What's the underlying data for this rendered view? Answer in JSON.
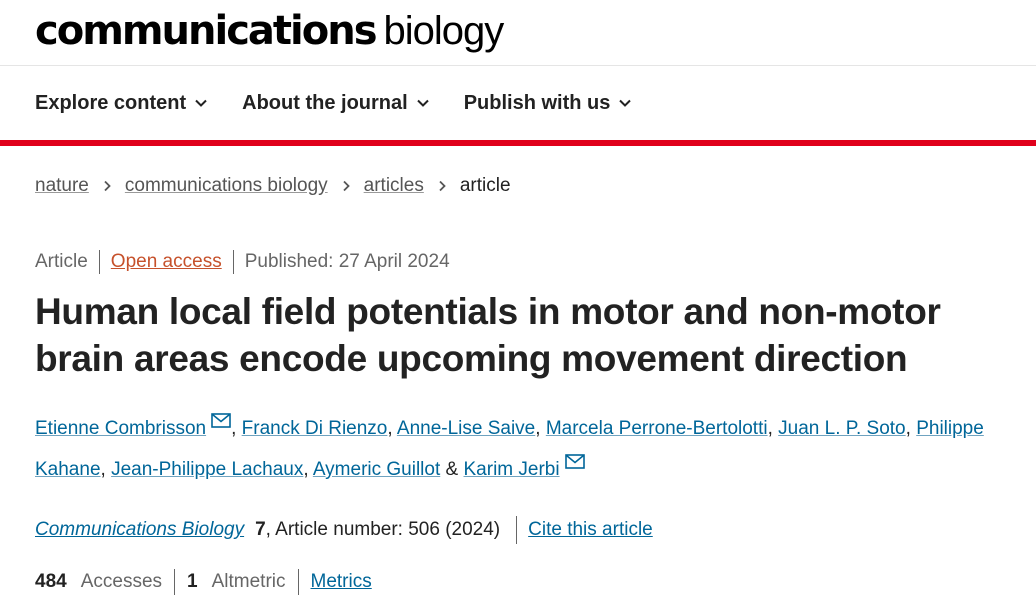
{
  "logo": {
    "bold": "communications",
    "light": "biology"
  },
  "nav": {
    "items": [
      {
        "label": "Explore content"
      },
      {
        "label": "About the journal"
      },
      {
        "label": "Publish with us"
      }
    ]
  },
  "breadcrumb": {
    "items": [
      "nature",
      "communications biology",
      "articles"
    ],
    "current": "article"
  },
  "meta": {
    "type": "Article",
    "access": "Open access",
    "published": "Published: 27 April 2024"
  },
  "title": "Human local field potentials in motor and non-motor brain areas encode upcoming movement direction",
  "authors": [
    "Etienne Combrisson",
    "Franck Di Rienzo",
    "Anne-Lise Saive",
    "Marcela Perrone-Bertolotti",
    "Juan L. P. Soto",
    "Philippe Kahane",
    "Jean-Philippe Lachaux",
    "Aymeric Guillot",
    "Karim Jerbi"
  ],
  "author_separators": {
    "comma": ",",
    "and": "&"
  },
  "citation": {
    "journal": "Communications Biology",
    "volume": "7",
    "details": ", Article number: 506 (2024)",
    "cite_label": "Cite this article"
  },
  "metrics": {
    "accesses_count": "484",
    "accesses_label": "Accesses",
    "altmetric_count": "1",
    "altmetric_label": "Altmetric",
    "metrics_label": "Metrics"
  },
  "colors": {
    "accent_red": "#e0001b",
    "link_blue": "#006699",
    "open_access_orange": "#c6512b"
  }
}
